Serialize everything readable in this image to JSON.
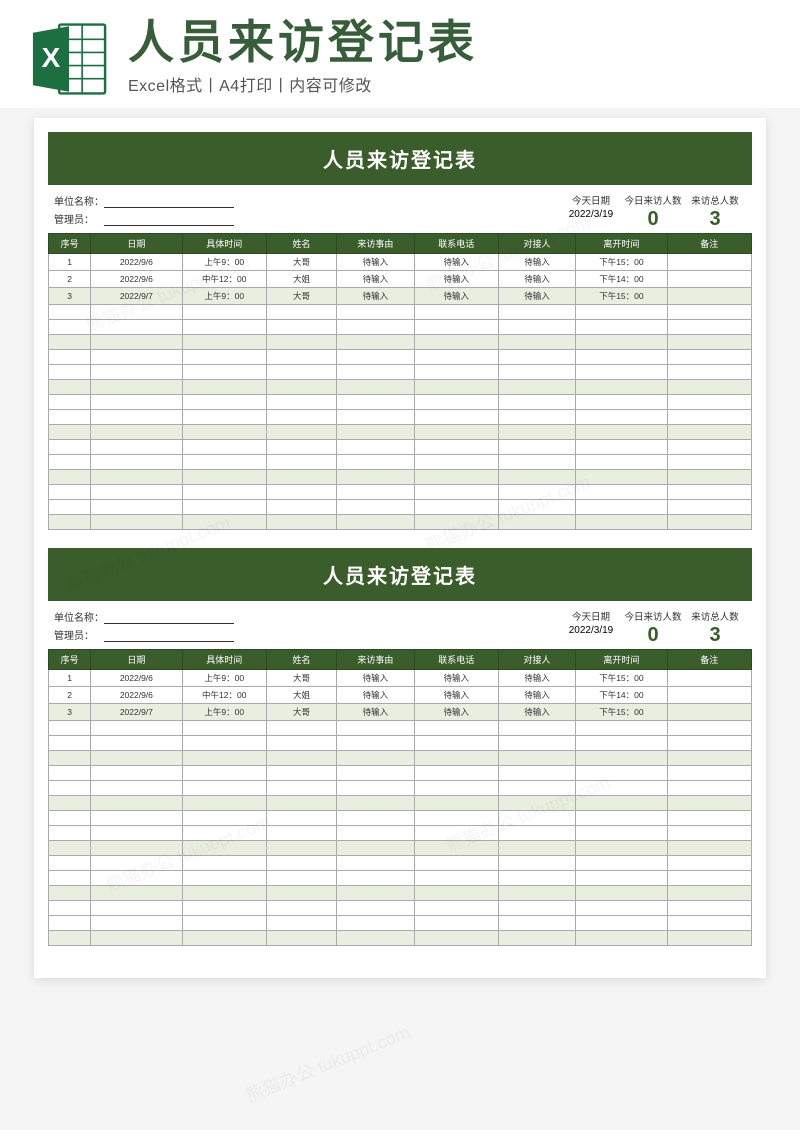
{
  "header": {
    "page_title": "人员来访登记表",
    "subtitle": "Excel格式丨A4打印丨内容可修改",
    "icon_name": "excel-icon"
  },
  "form": {
    "banner_title": "人员来访登记表",
    "labels": {
      "org": "单位名称：",
      "manager": "管理员：",
      "today": "今天日期",
      "today_count": "今日来访人数",
      "total_count": "来访总人数"
    },
    "stats": {
      "today_date": "2022/3/19",
      "today_count": "0",
      "total_count": "3"
    },
    "columns": [
      "序号",
      "日期",
      "具体时间",
      "姓名",
      "来访事由",
      "联系电话",
      "对接人",
      "离开时间",
      "备注"
    ],
    "rows": [
      {
        "seq": "1",
        "date": "2022/9/6",
        "time": "上午9：00",
        "name": "大哥",
        "reason": "待输入",
        "phone": "待输入",
        "contact": "待输入",
        "leave": "下午15：00",
        "note": ""
      },
      {
        "seq": "2",
        "date": "2022/9/6",
        "time": "中午12：00",
        "name": "大姐",
        "reason": "待输入",
        "phone": "待输入",
        "contact": "待输入",
        "leave": "下午14：00",
        "note": ""
      },
      {
        "seq": "3",
        "date": "2022/9/7",
        "time": "上午9：00",
        "name": "大哥",
        "reason": "待输入",
        "phone": "待输入",
        "contact": "待输入",
        "leave": "下午15：00",
        "note": ""
      }
    ],
    "empty_rows": 15
  },
  "watermark": "熊猫办公 tukuppt.com"
}
